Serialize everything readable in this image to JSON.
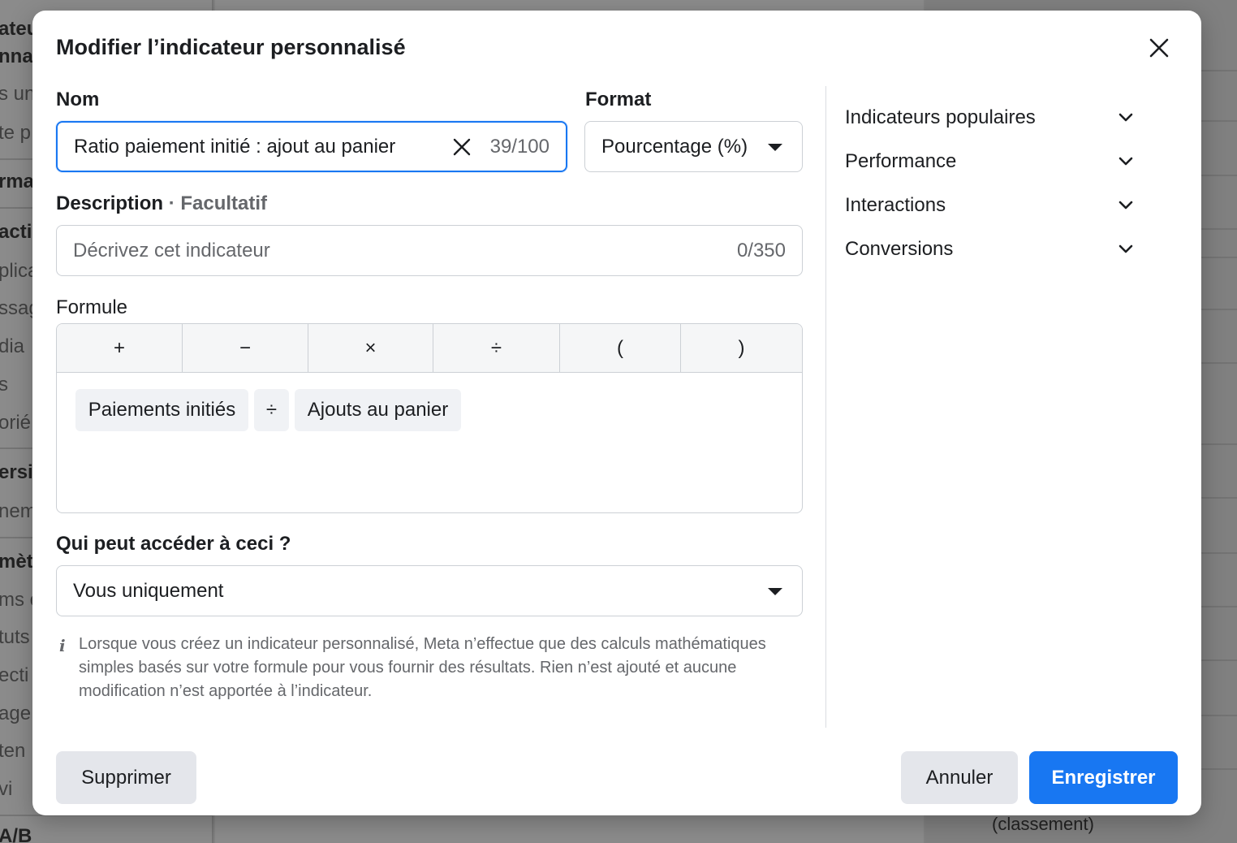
{
  "background": {
    "left_texts": [
      "ateu",
      "nna",
      "s un",
      "te p",
      "rma",
      "actio",
      "plica",
      "ssag",
      "dia",
      "s",
      "orié",
      "ersio",
      "nem",
      "mètr",
      "ms e",
      "tuts",
      "ecti",
      "age",
      "ten",
      "vi",
      "A/B"
    ],
    "right_text": "(classement)"
  },
  "modal": {
    "title": "Modifier l’indicateur personnalisé",
    "name": {
      "label": "Nom",
      "value": "Ratio paiement initié : ajout au panier",
      "counter": "39/100"
    },
    "format": {
      "label": "Format",
      "value": "Pourcentage (%)"
    },
    "description": {
      "label": "Description",
      "separator": "·",
      "optional": "Facultatif",
      "placeholder": "Décrivez cet indicateur",
      "counter": "0/350"
    },
    "formula": {
      "label": "Formule",
      "operators": [
        "+",
        "−",
        "×",
        "÷",
        "(",
        ")"
      ],
      "tokens": [
        "Paiements initiés",
        "÷",
        "Ajouts au panier"
      ]
    },
    "access": {
      "label": "Qui peut accéder à ceci ?",
      "value": "Vous uniquement"
    },
    "info": {
      "icon": "info-icon",
      "text": "Lorsque vous créez un indicateur personnalisé, Meta n’effectue que des calculs mathématiques simples basés sur votre formule pour vous fournir des résultats. Rien n’est ajouté et aucune modification n’est apportée à l’indicateur."
    },
    "categories": [
      "Indicateurs populaires",
      "Performance",
      "Interactions",
      "Conversions"
    ],
    "footer": {
      "delete_label": "Supprimer",
      "cancel_label": "Annuler",
      "save_label": "Enregistrer"
    }
  },
  "colors": {
    "accent": "#1877f2",
    "secondary_text": "#65676b",
    "button_gray": "#e4e6eb"
  }
}
